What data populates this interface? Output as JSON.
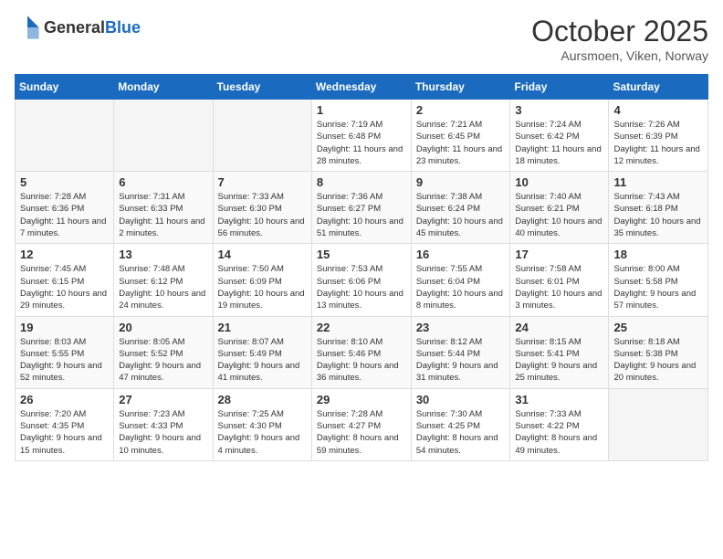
{
  "header": {
    "logo_general": "General",
    "logo_blue": "Blue",
    "month": "October 2025",
    "location": "Aursmoen, Viken, Norway"
  },
  "days_of_week": [
    "Sunday",
    "Monday",
    "Tuesday",
    "Wednesday",
    "Thursday",
    "Friday",
    "Saturday"
  ],
  "weeks": [
    [
      {
        "day": "",
        "info": ""
      },
      {
        "day": "",
        "info": ""
      },
      {
        "day": "",
        "info": ""
      },
      {
        "day": "1",
        "info": "Sunrise: 7:19 AM\nSunset: 6:48 PM\nDaylight: 11 hours and 28 minutes."
      },
      {
        "day": "2",
        "info": "Sunrise: 7:21 AM\nSunset: 6:45 PM\nDaylight: 11 hours and 23 minutes."
      },
      {
        "day": "3",
        "info": "Sunrise: 7:24 AM\nSunset: 6:42 PM\nDaylight: 11 hours and 18 minutes."
      },
      {
        "day": "4",
        "info": "Sunrise: 7:26 AM\nSunset: 6:39 PM\nDaylight: 11 hours and 12 minutes."
      }
    ],
    [
      {
        "day": "5",
        "info": "Sunrise: 7:28 AM\nSunset: 6:36 PM\nDaylight: 11 hours and 7 minutes."
      },
      {
        "day": "6",
        "info": "Sunrise: 7:31 AM\nSunset: 6:33 PM\nDaylight: 11 hours and 2 minutes."
      },
      {
        "day": "7",
        "info": "Sunrise: 7:33 AM\nSunset: 6:30 PM\nDaylight: 10 hours and 56 minutes."
      },
      {
        "day": "8",
        "info": "Sunrise: 7:36 AM\nSunset: 6:27 PM\nDaylight: 10 hours and 51 minutes."
      },
      {
        "day": "9",
        "info": "Sunrise: 7:38 AM\nSunset: 6:24 PM\nDaylight: 10 hours and 45 minutes."
      },
      {
        "day": "10",
        "info": "Sunrise: 7:40 AM\nSunset: 6:21 PM\nDaylight: 10 hours and 40 minutes."
      },
      {
        "day": "11",
        "info": "Sunrise: 7:43 AM\nSunset: 6:18 PM\nDaylight: 10 hours and 35 minutes."
      }
    ],
    [
      {
        "day": "12",
        "info": "Sunrise: 7:45 AM\nSunset: 6:15 PM\nDaylight: 10 hours and 29 minutes."
      },
      {
        "day": "13",
        "info": "Sunrise: 7:48 AM\nSunset: 6:12 PM\nDaylight: 10 hours and 24 minutes."
      },
      {
        "day": "14",
        "info": "Sunrise: 7:50 AM\nSunset: 6:09 PM\nDaylight: 10 hours and 19 minutes."
      },
      {
        "day": "15",
        "info": "Sunrise: 7:53 AM\nSunset: 6:06 PM\nDaylight: 10 hours and 13 minutes."
      },
      {
        "day": "16",
        "info": "Sunrise: 7:55 AM\nSunset: 6:04 PM\nDaylight: 10 hours and 8 minutes."
      },
      {
        "day": "17",
        "info": "Sunrise: 7:58 AM\nSunset: 6:01 PM\nDaylight: 10 hours and 3 minutes."
      },
      {
        "day": "18",
        "info": "Sunrise: 8:00 AM\nSunset: 5:58 PM\nDaylight: 9 hours and 57 minutes."
      }
    ],
    [
      {
        "day": "19",
        "info": "Sunrise: 8:03 AM\nSunset: 5:55 PM\nDaylight: 9 hours and 52 minutes."
      },
      {
        "day": "20",
        "info": "Sunrise: 8:05 AM\nSunset: 5:52 PM\nDaylight: 9 hours and 47 minutes."
      },
      {
        "day": "21",
        "info": "Sunrise: 8:07 AM\nSunset: 5:49 PM\nDaylight: 9 hours and 41 minutes."
      },
      {
        "day": "22",
        "info": "Sunrise: 8:10 AM\nSunset: 5:46 PM\nDaylight: 9 hours and 36 minutes."
      },
      {
        "day": "23",
        "info": "Sunrise: 8:12 AM\nSunset: 5:44 PM\nDaylight: 9 hours and 31 minutes."
      },
      {
        "day": "24",
        "info": "Sunrise: 8:15 AM\nSunset: 5:41 PM\nDaylight: 9 hours and 25 minutes."
      },
      {
        "day": "25",
        "info": "Sunrise: 8:18 AM\nSunset: 5:38 PM\nDaylight: 9 hours and 20 minutes."
      }
    ],
    [
      {
        "day": "26",
        "info": "Sunrise: 7:20 AM\nSunset: 4:35 PM\nDaylight: 9 hours and 15 minutes."
      },
      {
        "day": "27",
        "info": "Sunrise: 7:23 AM\nSunset: 4:33 PM\nDaylight: 9 hours and 10 minutes."
      },
      {
        "day": "28",
        "info": "Sunrise: 7:25 AM\nSunset: 4:30 PM\nDaylight: 9 hours and 4 minutes."
      },
      {
        "day": "29",
        "info": "Sunrise: 7:28 AM\nSunset: 4:27 PM\nDaylight: 8 hours and 59 minutes."
      },
      {
        "day": "30",
        "info": "Sunrise: 7:30 AM\nSunset: 4:25 PM\nDaylight: 8 hours and 54 minutes."
      },
      {
        "day": "31",
        "info": "Sunrise: 7:33 AM\nSunset: 4:22 PM\nDaylight: 8 hours and 49 minutes."
      },
      {
        "day": "",
        "info": ""
      }
    ]
  ]
}
